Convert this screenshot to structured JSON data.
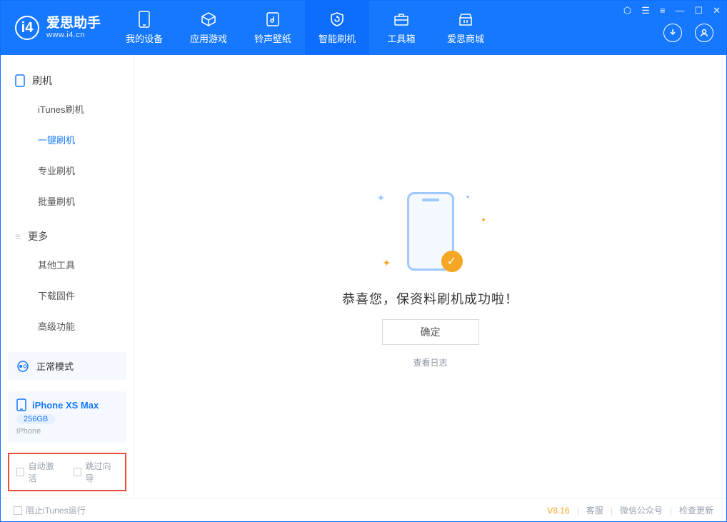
{
  "app": {
    "name": "爱思助手",
    "url": "www.i4.cn"
  },
  "header_tabs": [
    {
      "label": "我的设备"
    },
    {
      "label": "应用游戏"
    },
    {
      "label": "铃声壁纸"
    },
    {
      "label": "智能刷机"
    },
    {
      "label": "工具箱"
    },
    {
      "label": "爱思商城"
    }
  ],
  "sidebar": {
    "group1_title": "刷机",
    "items1": [
      {
        "label": "iTunes刷机"
      },
      {
        "label": "一键刷机"
      },
      {
        "label": "专业刷机"
      },
      {
        "label": "批量刷机"
      }
    ],
    "group2_title": "更多",
    "items2": [
      {
        "label": "其他工具"
      },
      {
        "label": "下载固件"
      },
      {
        "label": "高级功能"
      }
    ],
    "mode_label": "正常模式",
    "device": {
      "name": "iPhone XS Max",
      "storage": "256GB",
      "type": "iPhone"
    },
    "checks": {
      "auto_activate": "自动激活",
      "skip_guide": "跳过向导"
    }
  },
  "main": {
    "message": "恭喜您，保资料刷机成功啦！",
    "ok_label": "确定",
    "log_link": "查看日志"
  },
  "footer": {
    "block_itunes": "阻止iTunes运行",
    "version": "V8.16",
    "kefu": "客服",
    "wechat": "微信公众号",
    "update": "检查更新"
  }
}
